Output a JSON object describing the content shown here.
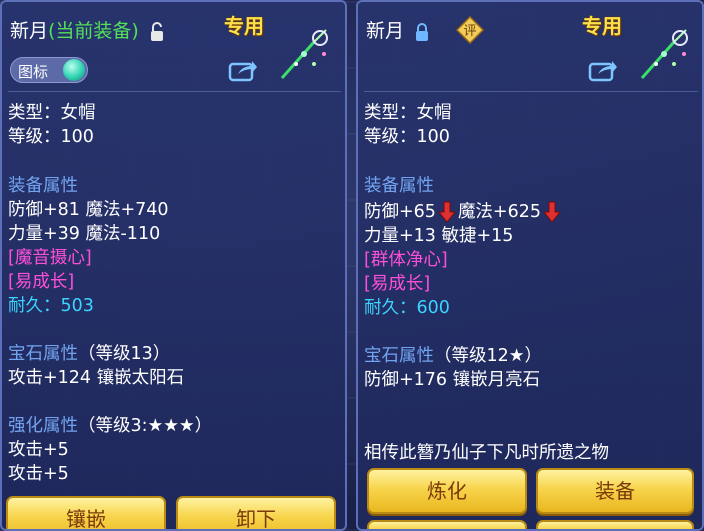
{
  "left": {
    "title_name": "新月",
    "title_state": "(当前装备)",
    "badge": "专用",
    "toggle_label": "图标",
    "type_line": "类型：女帽",
    "level_line": "等级：100",
    "equip_attr_heading": "装备属性",
    "attr_line_1": "防御+81 魔法+740",
    "attr_line_2": "力量+39 魔法-110",
    "special_1": "[魔音摄心]",
    "special_2": "[易成长]",
    "durability": "耐久：503",
    "gem_heading": "宝石属性",
    "gem_level": "（等级13）",
    "gem_line": "攻击+124 镶嵌太阳石",
    "enhance_heading": "强化属性",
    "enhance_level": "（等级3:★★★）",
    "enhance_line_1": "攻击+5",
    "enhance_line_2": "攻击+5",
    "buttons": [
      "镶嵌",
      "卸下"
    ]
  },
  "right": {
    "title_name": "新月",
    "rating_icon_text": "评",
    "badge": "专用",
    "type_line": "类型：女帽",
    "level_line": "等级：100",
    "equip_attr_heading": "装备属性",
    "attr_1a": "防御+65",
    "attr_1b": "魔法+625",
    "attr_line_2": "力量+13 敏捷+15",
    "special_1": "[群体净心]",
    "special_2": "[易成长]",
    "durability": "耐久：600",
    "gem_heading": "宝石属性",
    "gem_level": "（等级12★）",
    "gem_line": "防御+176 镶嵌月亮石",
    "description": "相传此簪乃仙子下凡时所遗之物",
    "buttons": [
      "炼化",
      "装备"
    ]
  },
  "colors": {
    "label_blue": "#73a4f0",
    "special_pink": "#ff4fd8",
    "durability_cyan": "#3cd4ff",
    "equipped_green": "#52e05a",
    "exclusive_gold": "#ffe04a",
    "decrease_red": "#e03030"
  },
  "icons": [
    "lock-open-icon",
    "lock-closed-icon",
    "rating-icon",
    "share-icon",
    "hairpin-item-icon",
    "down-arrow-icon"
  ]
}
